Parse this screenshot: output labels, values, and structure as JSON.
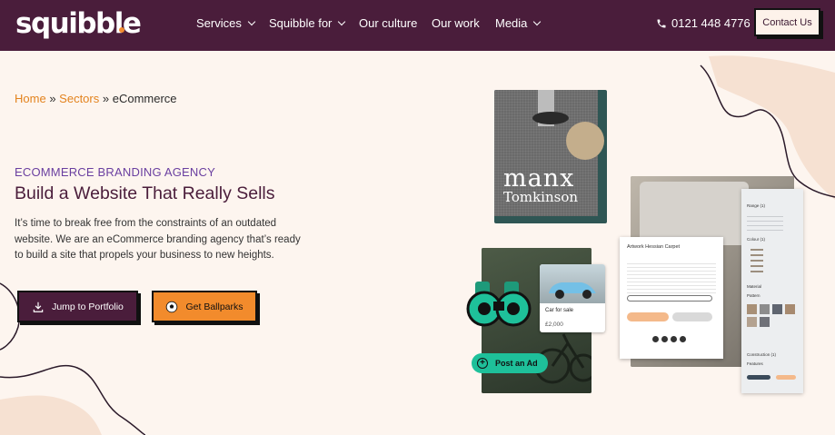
{
  "header": {
    "logo_text": "squibble",
    "nav": [
      {
        "label": "Services",
        "has_dropdown": true
      },
      {
        "label": "Squibble for",
        "has_dropdown": true
      },
      {
        "label": "Our culture",
        "has_dropdown": false
      },
      {
        "label": "Our work",
        "has_dropdown": false
      },
      {
        "label": "Media",
        "has_dropdown": true
      }
    ],
    "phone": "0121 448 4776",
    "contact_label": "Contact Us"
  },
  "breadcrumb": {
    "home": "Home",
    "sep": "»",
    "sectors": "Sectors",
    "current": "eCommerce"
  },
  "hero": {
    "kicker": "ECOMMERCE BRANDING AGENCY",
    "title": "Build a Website That Really Sells",
    "description": "It’s time to break free from the constraints of an outdated website. We are an eCommerce branding agency that’s ready to build a site that propels your business to new heights.",
    "btn_portfolio": "Jump to Portfolio",
    "btn_ballparks": "Get Ballparks"
  },
  "showcase": {
    "manx_line1": "manx",
    "manx_line2": "Tomkinson",
    "car_title": "Car for sale",
    "car_price": "£2,000",
    "post_ad": "Post an Ad",
    "carpet_title": "Artwork Hessian Carpet",
    "filter_range": "Range (1)",
    "filter_colour": "Colour (1)",
    "filter_material": "Material",
    "filter_pattern": "Pattern",
    "filter_construction": "Construction (1)",
    "filter_features": "Features"
  },
  "colors": {
    "brand": "#4a1d3b",
    "accent": "#f28b2c",
    "background": "#fdf5ef",
    "kicker": "#6a3fa0"
  }
}
